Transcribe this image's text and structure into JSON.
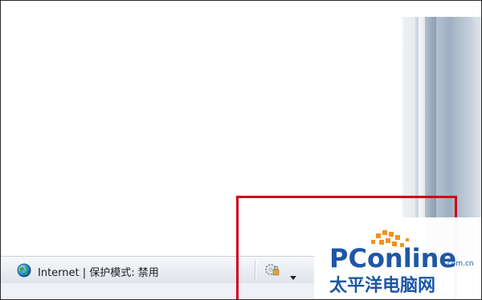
{
  "statusbar": {
    "zone_text": "Internet | 保护模式: 禁用"
  },
  "icons": {
    "globe": "globe-icon",
    "lock": "lock-gear-icon",
    "dropdown": "chevron-down-icon"
  },
  "highlight": {
    "color": "#d0001a"
  },
  "watermark": {
    "brand": "PConline",
    "domain": ".com.cn",
    "chinese": "太平洋电脑网"
  }
}
